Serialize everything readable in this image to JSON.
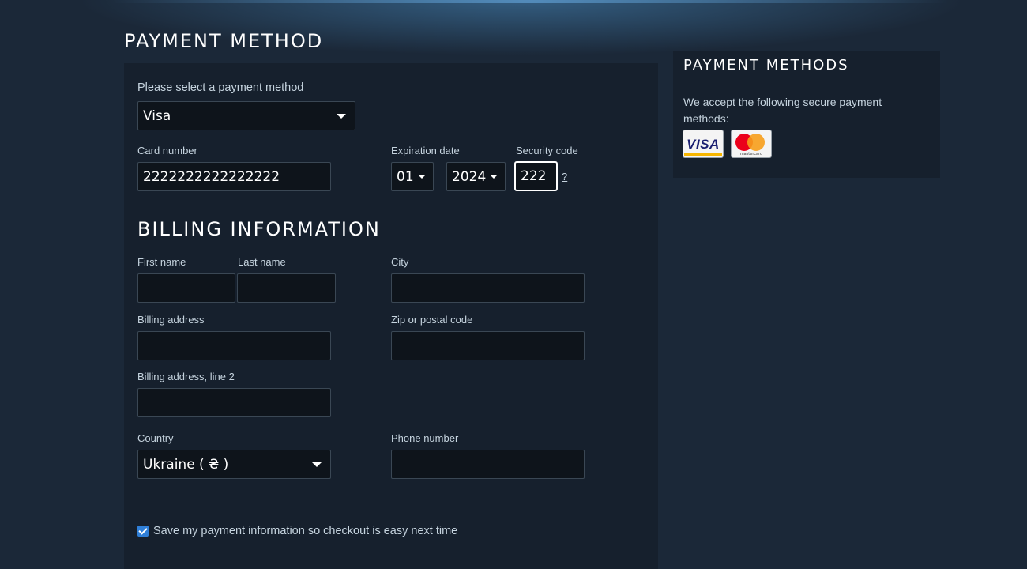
{
  "page_title": "PAYMENT METHOD",
  "payment": {
    "select_label": "Please select a payment method",
    "selected_method": "Visa",
    "card_number_label": "Card number",
    "card_number_value": "2222222222222222",
    "expiration_label": "Expiration date",
    "exp_month": "01",
    "exp_year": "2024",
    "security_label": "Security code",
    "security_value": "222",
    "help_link": "?"
  },
  "billing": {
    "title": "BILLING INFORMATION",
    "first_name_label": "First name",
    "first_name_value": "",
    "last_name_label": "Last name",
    "last_name_value": "",
    "city_label": "City",
    "city_value": "",
    "address_label": "Billing address",
    "address_value": "",
    "zip_label": "Zip or postal code",
    "zip_value": "",
    "address2_label": "Billing address, line 2",
    "address2_value": "",
    "country_label": "Country",
    "country_value": "Ukraine ( ₴ )",
    "phone_label": "Phone number",
    "phone_value": ""
  },
  "save_info": {
    "checked": true,
    "label": "Save my payment information so checkout is easy next time"
  },
  "sidebar": {
    "title": "PAYMENT METHODS",
    "description": "We accept the following secure payment methods:",
    "cards": [
      {
        "icon": "visa-card-icon",
        "text": "VISA"
      },
      {
        "icon": "mastercard-card-icon",
        "text": "mastercard"
      }
    ]
  },
  "colors": {
    "background": "#1b2838",
    "panel": "#16202d",
    "field": "#0e141b",
    "checkbox": "#2f7fd8"
  }
}
